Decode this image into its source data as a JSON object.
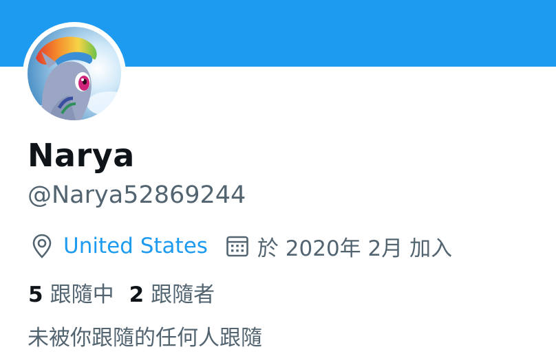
{
  "banner": {
    "color": "#1d9bf0"
  },
  "avatar": {
    "description": "pony-character-avatar"
  },
  "profile": {
    "display_name": "Narya",
    "handle": "@Narya52869244",
    "location": "United States",
    "joined": "於 2020年 2月 加入"
  },
  "icons": {
    "location": "location-pin-icon",
    "calendar": "calendar-icon"
  },
  "stats": {
    "following_count": "5",
    "following_label": "跟隨中",
    "followers_count": "2",
    "followers_label": "跟隨者"
  },
  "mutual_note": "未被你跟隨的任何人跟隨",
  "colors": {
    "accent": "#1d9bf0",
    "text_primary": "#0f1419",
    "text_secondary": "#536471"
  }
}
